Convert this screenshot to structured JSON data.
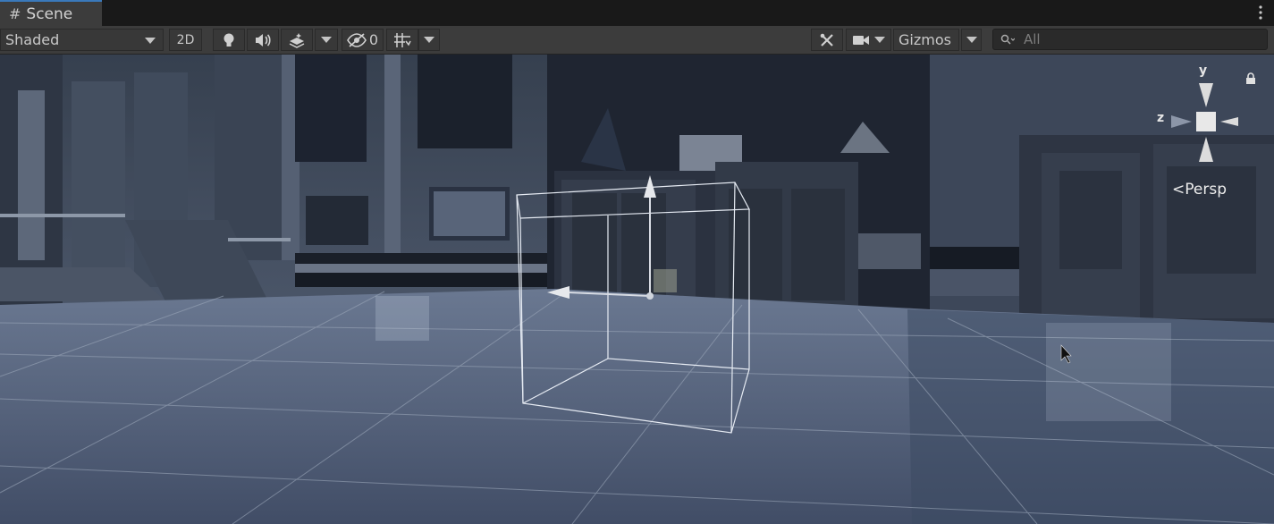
{
  "window": {
    "tab_label": "Scene",
    "tab_icon": "hash-grid-icon",
    "more_menu_icon": "kebab-icon"
  },
  "toolbar": {
    "draw_mode": "Shaded",
    "toggle_2d": "2D",
    "lighting_icon": "lightbulb-icon",
    "audio_icon": "speaker-icon",
    "effects_icon": "layers-effects-icon",
    "hidden_count": "0",
    "grid_icon": "grid-snap-icon",
    "tools_icon": "wrench-tools-icon",
    "camera_icon": "camera-icon",
    "gizmos_label": "Gizmos",
    "search_placeholder": "All"
  },
  "scene_gizmo": {
    "axis_y": "y",
    "axis_z": "z",
    "projection": "Persp",
    "lock_icon": "lock-icon"
  },
  "colors": {
    "accent": "#3a79bb",
    "toolbar_bg": "#3c3c3c",
    "viewport_tint": "#2f3d58"
  }
}
